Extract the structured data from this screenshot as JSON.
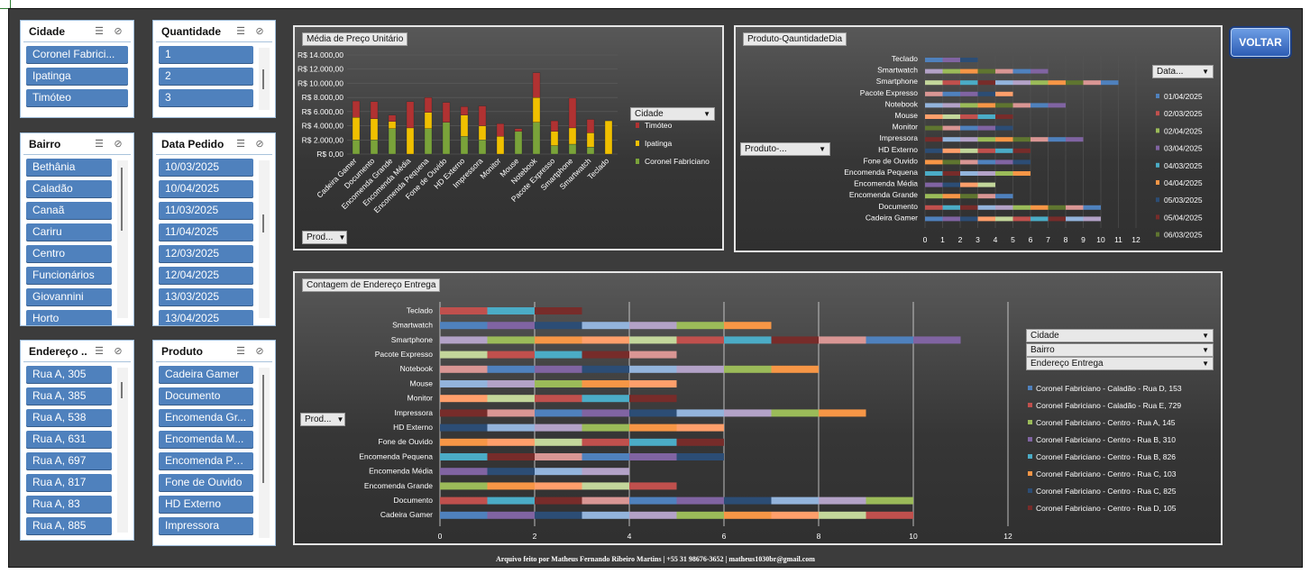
{
  "slicers": {
    "cidade": {
      "title": "Cidade",
      "items": [
        "Coronel Fabrici...",
        "Ipatinga",
        "Timóteo"
      ]
    },
    "quantidade": {
      "title": "Quantidade",
      "items": [
        "1",
        "2",
        "3"
      ]
    },
    "bairro": {
      "title": "Bairro",
      "items": [
        "Bethânia",
        "Caladão",
        "Canaã",
        "Cariru",
        "Centro",
        "Funcionários",
        "Giovannini",
        "Horto"
      ]
    },
    "data_pedido": {
      "title": "Data Pedido",
      "items": [
        "10/03/2025",
        "10/04/2025",
        "11/03/2025",
        "11/04/2025",
        "12/03/2025",
        "12/04/2025",
        "13/03/2025",
        "13/04/2025"
      ]
    },
    "endereco": {
      "title": "Endereço ...",
      "items": [
        "Rua A, 305",
        "Rua A, 385",
        "Rua A, 538",
        "Rua A, 631",
        "Rua A, 697",
        "Rua A, 817",
        "Rua A, 83",
        "Rua A, 885"
      ]
    },
    "produto": {
      "title": "Produto",
      "items": [
        "Cadeira Gamer",
        "Documento",
        "Encomenda Gr...",
        "Encomenda M...",
        "Encomenda Pe...",
        "Fone de Ouvido",
        "HD Externo",
        "Impressora"
      ]
    }
  },
  "voltar_label": "VOLTAR",
  "footer_text": "Arquivo feito por Matheus Fernando Ribeiro Martins | +55 31 98676-3652 | matheus1030br@gmail.com",
  "icons": {
    "multiselect": "multi-select-icon",
    "clear_filter": "clear-filter-icon"
  },
  "chart_data": [
    {
      "id": "preco",
      "type": "bar",
      "title": "Média de Preço Unitário",
      "field_button": "Prod...",
      "legend_title": "Cidade",
      "legend_position": "right",
      "categories": [
        "Cadeira Gamer",
        "Documento",
        "Encomenda Grande",
        "Encomenda Média",
        "Encomenda Pequena",
        "Fone de Ouvido",
        "HD Externo",
        "Impressora",
        "Monitor",
        "Mouse",
        "Notebook",
        "Pacote Expresso",
        "Smartphone",
        "Smartwatch",
        "Teclado"
      ],
      "series": [
        {
          "name": "Coronel Fabriciano",
          "color": "#7aa33a",
          "values": [
            2000,
            2000,
            3600,
            0,
            3600,
            4500,
            2500,
            2000,
            0,
            3200,
            4500,
            1200,
            1400,
            1000,
            0
          ]
        },
        {
          "name": "Ipatinga",
          "color": "#f0c000",
          "values": [
            3200,
            3000,
            1000,
            3700,
            2300,
            0,
            3000,
            2000,
            2500,
            0,
            3500,
            2000,
            2300,
            2000,
            4700
          ]
        },
        {
          "name": "Timóteo",
          "color": "#b13232",
          "values": [
            2300,
            2400,
            900,
            3700,
            2100,
            2800,
            1200,
            2800,
            1800,
            400,
            3500,
            1500,
            4200,
            1900,
            0
          ]
        }
      ],
      "y_ticks": [
        "R$ 0,00",
        "R$ 2.000,00",
        "R$ 4.000,00",
        "R$ 6.000,00",
        "R$ 8.000,00",
        "R$ 10.000,00",
        "R$ 12.000,00",
        "R$ 14.000,00"
      ],
      "ylim": [
        0,
        14000
      ]
    },
    {
      "id": "qtd",
      "type": "bar",
      "title": "Produto-QauntidadeDia",
      "field_button": "Produto-...",
      "legend_title": "Data...",
      "legend_position": "right",
      "categories": [
        "Cadeira Gamer",
        "Documento",
        "Encomenda Grande",
        "Encomenda Média",
        "Encomenda Pequena",
        "Fone de Ouvido",
        "HD Externo",
        "Impressora",
        "Monitor",
        "Mouse",
        "Notebook",
        "Pacote Expresso",
        "Smartphone",
        "Smartwatch",
        "Teclado"
      ],
      "totals": [
        10,
        10,
        5,
        4,
        6,
        6,
        6,
        9,
        5,
        5,
        8,
        5,
        11,
        7,
        3
      ],
      "legend": [
        {
          "name": "01/04/2025",
          "color": "#4f81bd"
        },
        {
          "name": "02/03/2025",
          "color": "#c0504d"
        },
        {
          "name": "02/04/2025",
          "color": "#9bbb59"
        },
        {
          "name": "03/04/2025",
          "color": "#8064a2"
        },
        {
          "name": "04/03/2025",
          "color": "#4bacc6"
        },
        {
          "name": "04/04/2025",
          "color": "#f79646"
        },
        {
          "name": "05/03/2025",
          "color": "#2c4d75"
        },
        {
          "name": "05/04/2025",
          "color": "#772c2a"
        },
        {
          "name": "06/03/2025",
          "color": "#5f7530"
        }
      ],
      "x_ticks": [
        "0",
        "1",
        "2",
        "3",
        "4",
        "5",
        "6",
        "7",
        "8",
        "9",
        "10",
        "11",
        "12"
      ],
      "xlim": [
        0,
        12
      ]
    },
    {
      "id": "endereco",
      "type": "bar",
      "title": "Contagem de Endereço Entrega",
      "field_button": "Prod...",
      "filter_buttons": [
        "Cidade",
        "Bairro",
        "Endereço Entrega"
      ],
      "legend_position": "right",
      "categories": [
        "Cadeira Gamer",
        "Documento",
        "Encomenda Grande",
        "Encomenda Média",
        "Encomenda Pequena",
        "Fone de Ouvido",
        "HD Externo",
        "Impressora",
        "Monitor",
        "Mouse",
        "Notebook",
        "Pacote Expresso",
        "Smartphone",
        "Smartwatch",
        "Teclado"
      ],
      "totals": [
        10,
        10,
        5,
        4,
        6,
        6,
        6,
        9,
        5,
        5,
        8,
        5,
        11,
        7,
        3
      ],
      "legend": [
        {
          "name": "Coronel Fabriciano - Caladão - Rua D, 153",
          "color": "#4f81bd"
        },
        {
          "name": "Coronel Fabriciano - Caladão - Rua E, 729",
          "color": "#c0504d"
        },
        {
          "name": "Coronel Fabriciano - Centro - Rua A, 145",
          "color": "#9bbb59"
        },
        {
          "name": "Coronel Fabriciano - Centro - Rua B, 310",
          "color": "#8064a2"
        },
        {
          "name": "Coronel Fabriciano - Centro - Rua B, 826",
          "color": "#4bacc6"
        },
        {
          "name": "Coronel Fabriciano - Centro - Rua C, 103",
          "color": "#f79646"
        },
        {
          "name": "Coronel Fabriciano - Centro - Rua C, 825",
          "color": "#2c4d75"
        },
        {
          "name": "Coronel Fabriciano - Centro - Rua D, 105",
          "color": "#772c2a"
        }
      ],
      "x_ticks": [
        "0",
        "2",
        "4",
        "6",
        "8",
        "10",
        "12"
      ],
      "xlim": [
        0,
        12
      ]
    }
  ]
}
